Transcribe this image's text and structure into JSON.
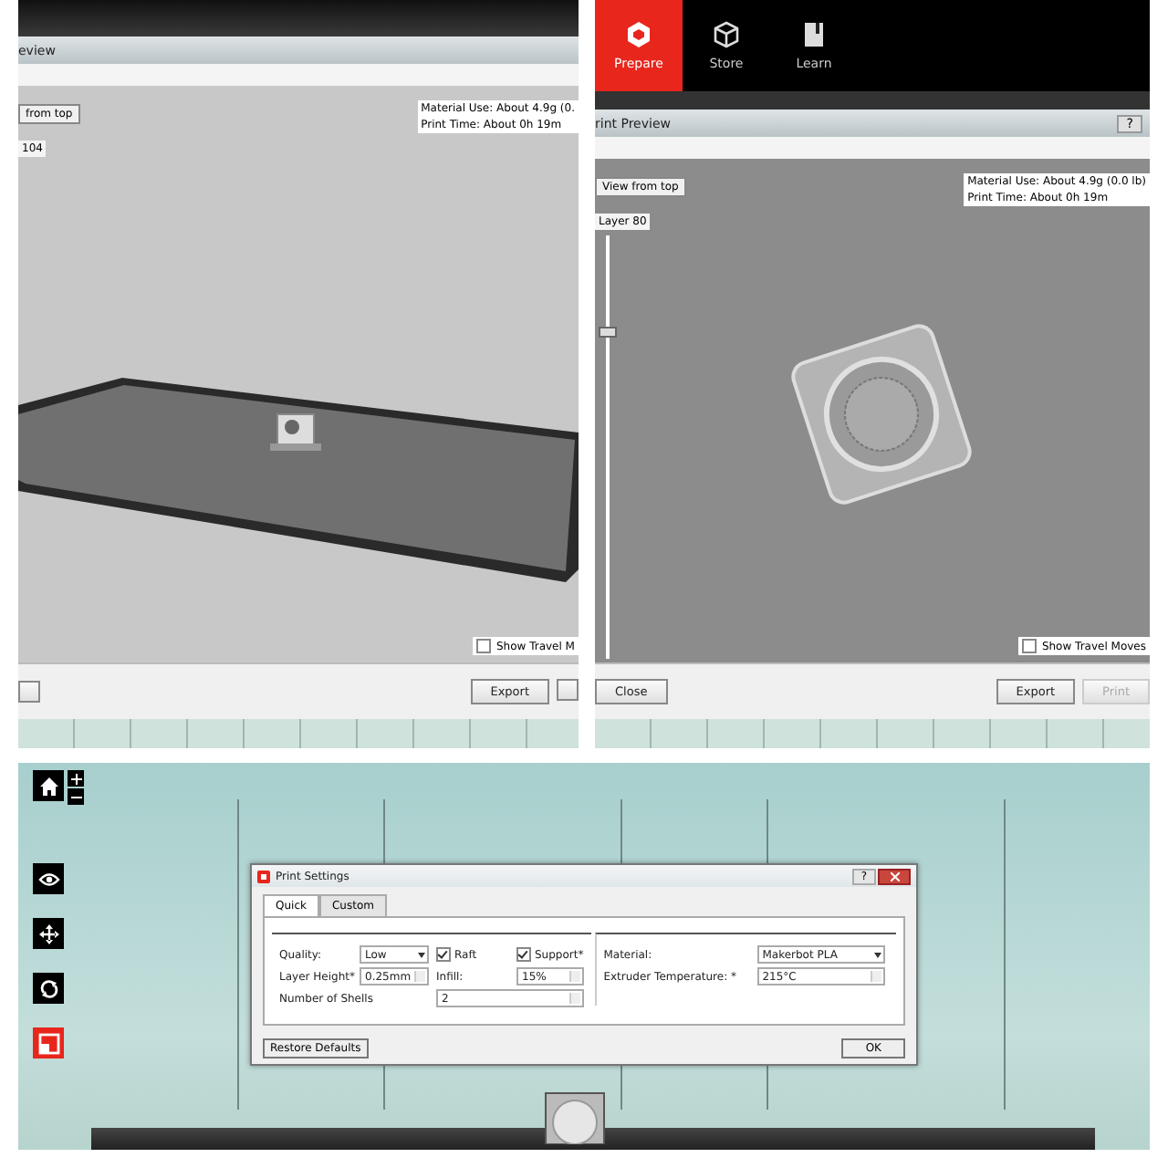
{
  "preview_left": {
    "title": "eview",
    "view_button": "from top",
    "layer_label": "104",
    "material_use": "Material Use: About 4.9g (0.",
    "print_time": "Print Time: About 0h 19m",
    "travel_moves": {
      "label": "Show Travel M",
      "checked": false
    },
    "buttons": [
      {
        "label": "Export",
        "disabled": false
      }
    ]
  },
  "preview_right": {
    "nav_tabs": [
      {
        "label": "Prepare",
        "selected": true,
        "kind": "prepare"
      },
      {
        "label": "Store",
        "selected": false,
        "kind": "store"
      },
      {
        "label": "Learn",
        "selected": false,
        "kind": "learn"
      }
    ],
    "title": "rint Preview",
    "help_button": "?",
    "view_button": "View from top",
    "layer_label": "Layer 80",
    "layer_slider": {
      "level": 0.78
    },
    "material_use": "Material Use: About 4.9g (0.0 lb)",
    "print_time": "Print Time: About 0h 19m",
    "travel_moves": {
      "label": "Show Travel Moves",
      "checked": false
    },
    "close_button": "Close",
    "buttons": [
      {
        "label": "Export",
        "disabled": false
      },
      {
        "label": "Print",
        "disabled": true
      }
    ]
  },
  "scene": {
    "toolbar": [
      {
        "kind": "eye",
        "selected": false
      },
      {
        "kind": "move",
        "selected": false
      },
      {
        "kind": "rotate",
        "selected": false
      },
      {
        "kind": "scale",
        "selected": true
      }
    ],
    "dialog": {
      "title": "Print Settings",
      "help_button": "?",
      "tabs": [
        {
          "label": "Quick",
          "selected": true
        },
        {
          "label": "Custom",
          "selected": false
        }
      ],
      "quality": {
        "label": "Quality:",
        "value": "Low"
      },
      "raft": {
        "label": "Raft",
        "checked": true
      },
      "support": {
        "label": "Support*",
        "checked": true
      },
      "layer_height": {
        "label": "Layer Height*",
        "value": "0.25mm"
      },
      "infill": {
        "label": "Infill:",
        "value": "15%"
      },
      "shells": {
        "label": "Number of Shells",
        "value": "2"
      },
      "material": {
        "label": "Material:",
        "value": "Makerbot PLA"
      },
      "extruder_temperature": {
        "label": "Extruder Temperature: *",
        "value": "215°C"
      },
      "restore_button": "Restore Defaults",
      "ok_button": "OK"
    }
  }
}
